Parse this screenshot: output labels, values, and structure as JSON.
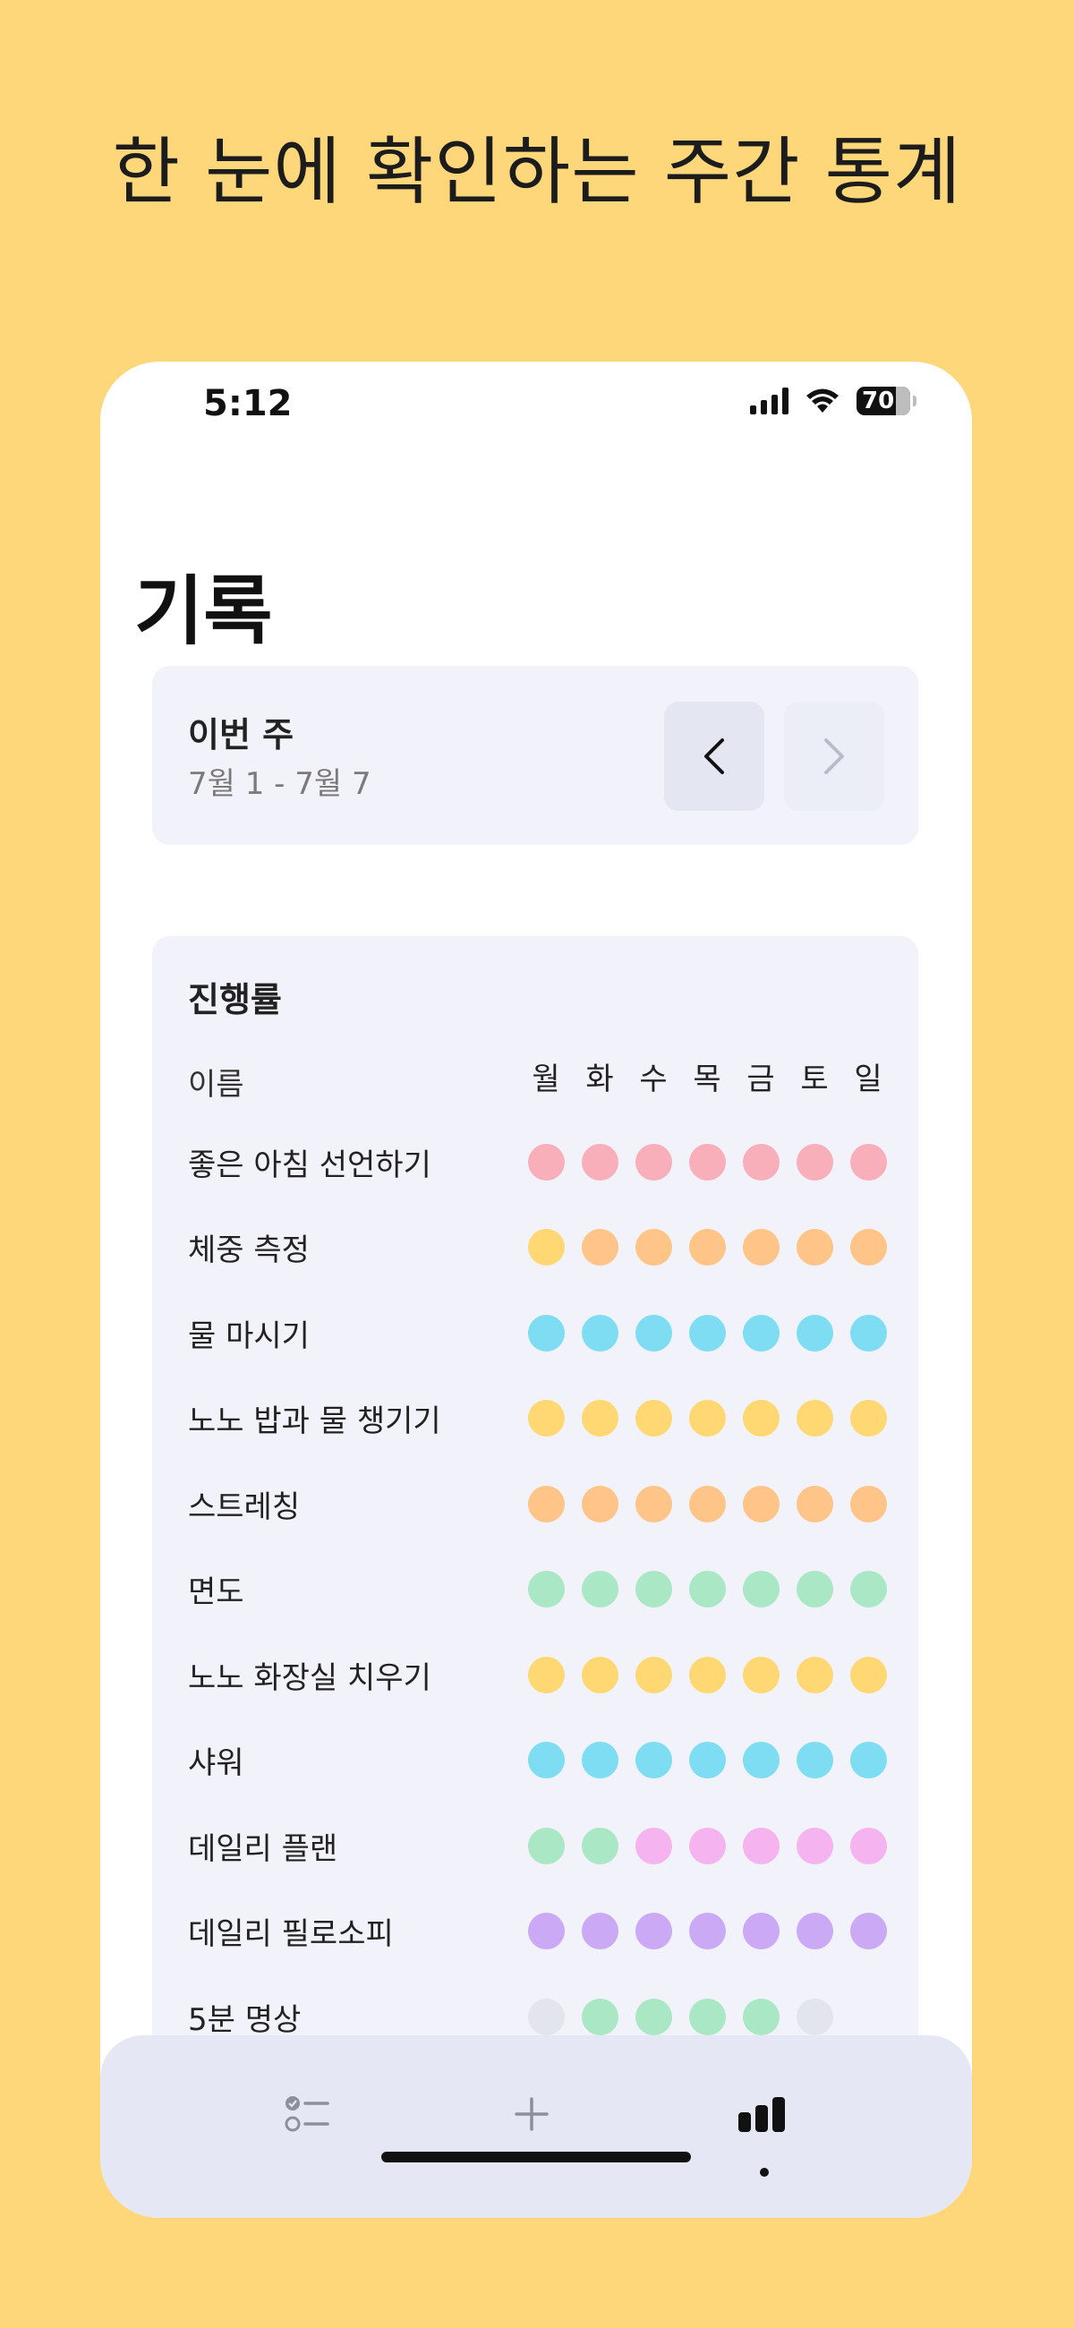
{
  "promo": {
    "headline": "한 눈에 확인하는 주간 통계"
  },
  "status_bar": {
    "time": "5:12",
    "battery": "70"
  },
  "page": {
    "title": "기록"
  },
  "week": {
    "label": "이번 주",
    "range": "7월 1 - 7월 7"
  },
  "progress": {
    "title": "진행률",
    "name_header": "이름",
    "days": [
      "월",
      "화",
      "수",
      "목",
      "금",
      "토",
      "일"
    ],
    "colors": {
      "pink": "#F8AFB9",
      "orange": "#FFC487",
      "yellow": "#FFD873",
      "cyan": "#7EDDF2",
      "mint": "#A9E7C5",
      "lilac": "#F5B3F0",
      "purple": "#CBA9F5",
      "gray": "#E3E5EC",
      "none": "transparent"
    },
    "habits": [
      {
        "name": "좋은 아침 선언하기",
        "days": [
          "pink",
          "pink",
          "pink",
          "pink",
          "pink",
          "pink",
          "pink"
        ]
      },
      {
        "name": "체중 측정",
        "days": [
          "yellow",
          "orange",
          "orange",
          "orange",
          "orange",
          "orange",
          "orange"
        ]
      },
      {
        "name": "물 마시기",
        "days": [
          "cyan",
          "cyan",
          "cyan",
          "cyan",
          "cyan",
          "cyan",
          "cyan"
        ]
      },
      {
        "name": "노노 밥과 물 챙기기",
        "days": [
          "yellow",
          "yellow",
          "yellow",
          "yellow",
          "yellow",
          "yellow",
          "yellow"
        ]
      },
      {
        "name": "스트레칭",
        "days": [
          "orange",
          "orange",
          "orange",
          "orange",
          "orange",
          "orange",
          "orange"
        ]
      },
      {
        "name": "면도",
        "days": [
          "mint",
          "mint",
          "mint",
          "mint",
          "mint",
          "mint",
          "mint"
        ]
      },
      {
        "name": "노노 화장실 치우기",
        "days": [
          "yellow",
          "yellow",
          "yellow",
          "yellow",
          "yellow",
          "yellow",
          "yellow"
        ]
      },
      {
        "name": "샤워",
        "days": [
          "cyan",
          "cyan",
          "cyan",
          "cyan",
          "cyan",
          "cyan",
          "cyan"
        ]
      },
      {
        "name": "데일리 플랜",
        "days": [
          "mint",
          "mint",
          "lilac",
          "lilac",
          "lilac",
          "lilac",
          "lilac"
        ]
      },
      {
        "name": "데일리 필로소피",
        "days": [
          "purple",
          "purple",
          "purple",
          "purple",
          "purple",
          "purple",
          "purple"
        ]
      },
      {
        "name": "5분 명상",
        "days": [
          "gray",
          "mint",
          "mint",
          "mint",
          "mint",
          "gray",
          "none"
        ]
      }
    ]
  },
  "tabbar": {
    "tabs": [
      {
        "name": "checklist-icon",
        "active": false
      },
      {
        "name": "plus-icon",
        "active": false
      },
      {
        "name": "stats-bar-chart-icon",
        "active": true
      }
    ]
  }
}
